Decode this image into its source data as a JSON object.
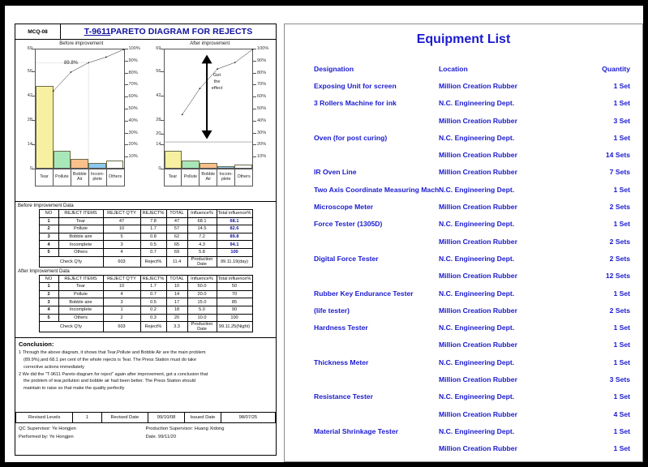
{
  "left_doc": {
    "doc_code": "MCQ-08",
    "title_code": "T-9611",
    "title_rest": " PARETO DIAGRAM FOR REJECTS",
    "chart_before_caption": "Before improvement",
    "chart_after_caption": "After improvement",
    "before_label_898": "89.8%",
    "after_annotation_lines": [
      "Get",
      "the",
      "effect"
    ],
    "table1_caption": "Before Improvement Data",
    "table2_caption": "After Improvement Data",
    "table_headers": [
      "NO",
      "REJECT ITEMS",
      "REJECT Q'TY",
      "REJECT%",
      "TOTAL",
      "Influence%",
      "Total influence%"
    ],
    "table1_rows": [
      [
        "1",
        "Tear",
        "47",
        "7.8",
        "47",
        "68.1",
        "68.1"
      ],
      [
        "2",
        "Pollute",
        "10",
        "1.7",
        "57",
        "14.5",
        "82.6"
      ],
      [
        "3",
        "Bobble aire",
        "5",
        "0.8",
        "62",
        "7.2",
        "89.8"
      ],
      [
        "4",
        "Incomplete",
        "3",
        "0.5",
        "65",
        "4.3",
        "94.1"
      ],
      [
        "5",
        "Others",
        "4",
        "0.7",
        "69",
        "5.8",
        "100"
      ]
    ],
    "table1_footer": {
      "check_qty_label": "Check Q'ty",
      "check_qty_value": "603",
      "reject_label": "Reject%",
      "reject_value": "11.4",
      "date_label": "Production Date",
      "date_value": "99.11.19(day)"
    },
    "table2_rows": [
      [
        "1",
        "Tear",
        "10",
        "1.7",
        "10",
        "50.0",
        "50"
      ],
      [
        "2",
        "Pollute",
        "4",
        "0.7",
        "14",
        "20.0",
        "70"
      ],
      [
        "3",
        "Bobble aire",
        "3",
        "0.5",
        "17",
        "15.0",
        "85"
      ],
      [
        "4",
        "Incomplete",
        "1",
        "0.2",
        "18",
        "5.0",
        "90"
      ],
      [
        "5",
        "Others",
        "2",
        "0.3",
        "20",
        "10.0",
        "100"
      ]
    ],
    "table2_footer": {
      "check_qty_label": "Check Q'ty",
      "check_qty_value": "603",
      "reject_label": "Reject%",
      "reject_value": "3.3",
      "date_label": "Production Date",
      "date_value": "99.11.25(Night)"
    },
    "conclusion_heading": "Conclusion:",
    "conclusion_lines": [
      "1 Through the above diagram, it shows that Tear,Pollute and Bobble Air are the main problem",
      "(89.9%),and 68.1 per cent of the whole rejects is Tear. The Press Station must do take",
      "corrective actions immediately",
      "2 We did the \"T-9611 Pareto diagram for reject\" again after improvement,  got a conclusion that",
      "the problem of  tear,pollution and bobble air had been  better. The Press Station should",
      "maintain to raise  so that make the quality  perfectly"
    ],
    "revision": {
      "levels_label": "Revised Levels",
      "levels_value": "1",
      "revised_date_label": "Revised Date",
      "revised_date_value": "99/10/08",
      "issued_date_label": "Issued Date",
      "issued_date_value": "98/07/25"
    },
    "signatures": {
      "qc_supervisor": "QC Supervisor: Ye Hongjen",
      "performed_by": "Performed by: Ye Hongjen",
      "production_supervisor": "Production Supervisor: Huang Xidong",
      "production_date": "Date. 99/11/20"
    }
  },
  "chart_data": [
    {
      "type": "bar",
      "title": "Before improvement",
      "categories": [
        "Tear",
        "Pollute",
        "Bobble Air",
        "Incom-plete",
        "Others"
      ],
      "values": [
        47,
        10,
        5,
        3,
        4
      ],
      "bar_colors": [
        "#f7f0a0",
        "#a8e8b8",
        "#f8c08a",
        "#8cc8f0",
        "#ffffff"
      ],
      "cumulative_percent": [
        68.1,
        82.6,
        89.8,
        94.1,
        100
      ],
      "ylabel": "",
      "ylim": [
        0,
        69
      ],
      "yticks": [
        0,
        14,
        28,
        42,
        56,
        69
      ],
      "y2ticks": [
        10,
        20,
        30,
        40,
        50,
        60,
        70,
        80,
        90,
        100
      ],
      "y2ticklabels": [
        "10%",
        "20%",
        "30%",
        "40%",
        "50%",
        "60%",
        "70%",
        "80%",
        "90%",
        "100%"
      ],
      "annotation": "89.8%",
      "grid": false,
      "legend": "none"
    },
    {
      "type": "bar",
      "title": "After improvement",
      "categories": [
        "Tear",
        "Pollute",
        "Bobble Air",
        "Incom-plete",
        "Others"
      ],
      "values": [
        10,
        4,
        3,
        1,
        2
      ],
      "bar_colors": [
        "#f7f0a0",
        "#a8e8b8",
        "#f8c08a",
        "#8cc8f0",
        "#ffffff"
      ],
      "cumulative_percent": [
        50,
        70,
        85,
        90,
        100
      ],
      "ylabel": "",
      "ylim": [
        0,
        69
      ],
      "yticks": [
        0,
        14,
        20,
        28,
        42,
        56,
        69
      ],
      "y2ticks": [
        10,
        20,
        30,
        40,
        50,
        60,
        70,
        80,
        90,
        100
      ],
      "y2ticklabels": [
        "10%",
        "20%",
        "30%",
        "40%",
        "50%",
        "60%",
        "70%",
        "80%",
        "90%",
        "100%"
      ],
      "annotation": "Get the effect",
      "reference_line": 20,
      "grid": false,
      "legend": "none"
    }
  ],
  "right_doc": {
    "title": "Equipment List",
    "headers": {
      "designation": "Designation",
      "location": "Location",
      "quantity": "Quantity"
    },
    "rows": [
      {
        "designation": "Exposing Unit for screen",
        "location": "Million Creation Rubber",
        "quantity": "1 Set"
      },
      {
        "designation": "3 Rollers Machine for ink",
        "location": "N.C. Engineering Dept.",
        "quantity": "1 Set"
      },
      {
        "designation": "",
        "location": "Million Creation Rubber",
        "quantity": "3 Set"
      },
      {
        "designation": "Oven (for post curing)",
        "location": "N.C. Engineering Dept.",
        "quantity": "1 Set"
      },
      {
        "designation": "",
        "location": "Million Creation Rubber",
        "quantity": "14 Sets"
      },
      {
        "designation": "IR Oven Line",
        "location": "Million Creation Rubber",
        "quantity": "7 Sets"
      },
      {
        "designation": "Two Axis Coordinate Measuring Machine",
        "location": "N.C. Engineering Dept.",
        "quantity": "1 Set"
      },
      {
        "designation": "Microscope Meter",
        "location": "Million Creation Rubber",
        "quantity": "2 Sets"
      },
      {
        "designation": "Force Tester (1305D)",
        "location": "N.C. Engineering Dept.",
        "quantity": "1 Set"
      },
      {
        "designation": "",
        "location": "Million Creation Rubber",
        "quantity": "2 Sets"
      },
      {
        "designation": " Digital Force Tester",
        "location": "N.C. Engineering Dept.",
        "quantity": "2 Sets"
      },
      {
        "designation": "",
        "location": "Million Creation Rubber",
        "quantity": "12 Sets"
      },
      {
        "designation": "Rubber Key Endurance Tester",
        "location": "N.C. Engineering Dept.",
        "quantity": "1 Set"
      },
      {
        "designation": "(life tester)",
        "location": "Million Creation Rubber",
        "quantity": "2 Sets"
      },
      {
        "designation": "Hardness Tester",
        "location": "N.C. Engineering Dept.",
        "quantity": "1 Set"
      },
      {
        "designation": "",
        "location": "Million Creation Rubber",
        "quantity": "1 Set"
      },
      {
        "designation": "Thickness Meter",
        "location": "N.C. Engineering Dept.",
        "quantity": "1 Set"
      },
      {
        "designation": "",
        "location": "Million Creation Rubber",
        "quantity": "3 Sets"
      },
      {
        "designation": "Resistance Tester",
        "location": "N.C. Engineering Dept.",
        "quantity": "1 Set"
      },
      {
        "designation": "",
        "location": "Million Creation Rubber",
        "quantity": "4 Set"
      },
      {
        "designation": "Material Shrinkage Tester",
        "location": "N.C. Engineering Dept.",
        "quantity": "1 Set"
      },
      {
        "designation": "",
        "location": "Million Creation Rubber",
        "quantity": "1 Set"
      }
    ]
  }
}
